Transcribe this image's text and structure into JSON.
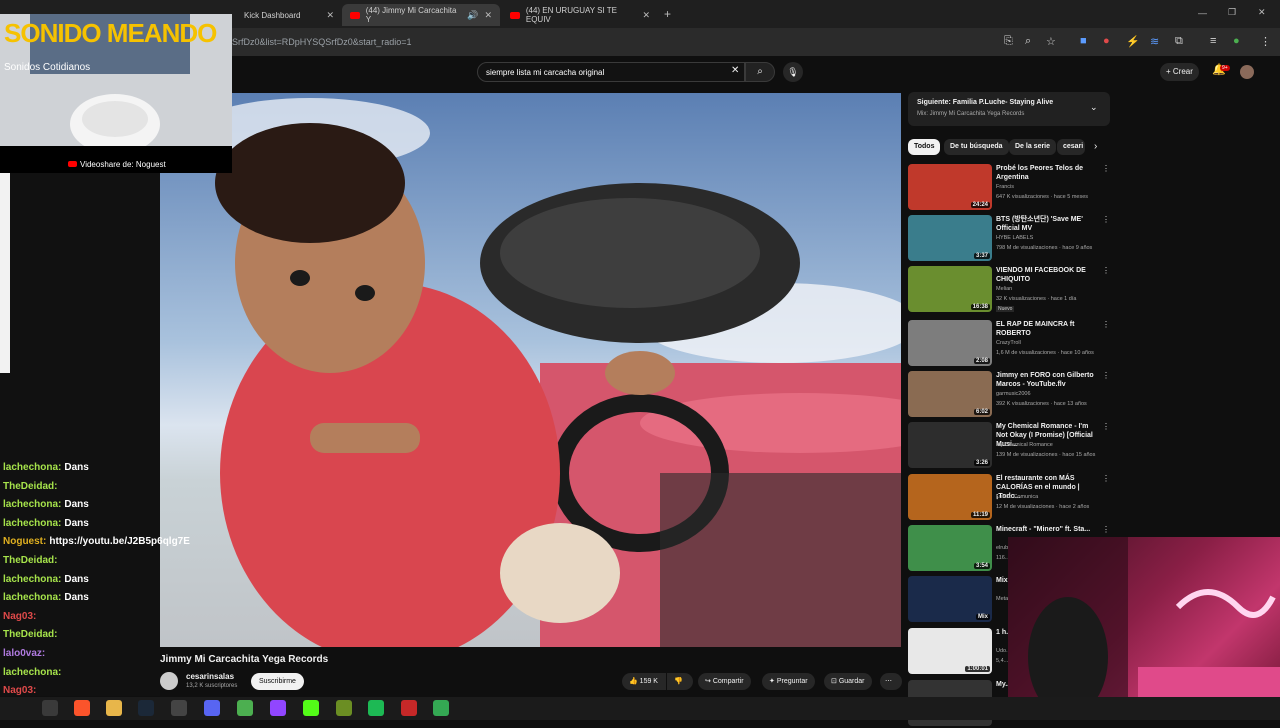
{
  "browser": {
    "tabs": [
      {
        "label": "Kick Dashboard",
        "active": false
      },
      {
        "label": "(44) Jimmy Mi Carcachita Y",
        "active": true
      },
      {
        "label": "(44) EN URUGUAY SI TE EQUIV",
        "active": false
      }
    ],
    "new_tab": "+",
    "address": "SrfDz0&list=RDpHYSQSrfDz0&start_radio=1"
  },
  "youtube": {
    "search_value": "siempre lista mi carcacha original",
    "crear_label": "Crear",
    "bell_badge": "9+",
    "video": {
      "title": "Jimmy Mi Carcachita Yega Records",
      "channel": "cesarinsalas",
      "subscribers": "13,2 K suscriptores",
      "subscribe_label": "Suscribirme",
      "likes": "159 K",
      "share_label": "Compartir",
      "ask_label": "Preguntar",
      "save_label": "Guardar"
    },
    "up_next": {
      "title": "Siguiente: Familia P.Luche- Staying Alive",
      "subtitle": "Mix: Jimmy Mi Carcachita Yega Records"
    },
    "chips": [
      "Todos",
      "De tu búsqueda",
      "De la serie",
      "cesari"
    ],
    "recommendations": [
      {
        "title": "Probé los Peores Telos de Argentina",
        "channel": "Francis",
        "meta": "647 K visualizaciones · hace 5 meses",
        "duration": "24:24",
        "color": "#c0392b"
      },
      {
        "title": "BTS (방탄소년단) 'Save ME' Official MV",
        "channel": "HYBE LABELS",
        "meta": "798 M de visualizaciones · hace 9 años",
        "duration": "3:37",
        "color": "#3a7d8c"
      },
      {
        "title": "VIENDO MI FACEBOOK DE CHIQUITO",
        "channel": "Melian",
        "meta": "32 K visualizaciones · hace 1 día",
        "duration": "16:38",
        "badge": "Nuevo",
        "color": "#6a8e2f"
      },
      {
        "title": "EL RAP DE MAINCRA ft ROBERTO",
        "channel": "CrazyTroll",
        "meta": "1,6 M de visualizaciones · hace 10 años",
        "duration": "2:08",
        "color": "#7d7d7d"
      },
      {
        "title": "Jimmy en FORO con Gilberto Marcos - YouTube.flv",
        "channel": "garmusic2006",
        "meta": "392 K visualizaciones · hace 13 años",
        "duration": "6:02",
        "color": "#8a6b52"
      },
      {
        "title": "My Chemical Romance - I'm Not Okay (I Promise) [Official Musi...",
        "channel": "My Chemical Romance",
        "meta": "139 M de visualizaciones · hace 15 años",
        "duration": "3:26",
        "color": "#2d2d2d"
      },
      {
        "title": "El restaurante con MÁS CALORÍAS en el mundo | ¡Todo...",
        "channel": "Luisito Comunica",
        "meta": "12 M de visualizaciones · hace 2 años",
        "duration": "11:19",
        "color": "#b5651d"
      },
      {
        "title": "Minecraft - \"Minero\" ft. Sta...",
        "channel": "elrub...",
        "meta": "116...",
        "duration": "3:54",
        "color": "#3f8f4a"
      },
      {
        "title": "Mix... Lar...",
        "channel": "Meta...",
        "meta": "",
        "duration": "Mix",
        "color": "#1a2a4a"
      },
      {
        "title": "1 h... inte...",
        "channel": "Udo...",
        "meta": "5,4...",
        "duration": "1:00:01",
        "color": "#e8e8e8"
      },
      {
        "title": "My...",
        "channel": "",
        "meta": "",
        "duration": "",
        "color": "#333"
      }
    ]
  },
  "overlay": {
    "brand": "SONIDO MEANDO",
    "subtitle": "Sonidos Cotidianos",
    "credit": "Videoshare de: Noguest"
  },
  "chat": [
    {
      "user": "lachechona:",
      "msg": "Dans",
      "color": "#a6e34b"
    },
    {
      "user": "TheDeidad:",
      "msg": "",
      "color": "#a6e34b"
    },
    {
      "user": "lachechona:",
      "msg": "Dans",
      "color": "#a6e34b"
    },
    {
      "user": "lachechona:",
      "msg": "Dans",
      "color": "#a6e34b"
    },
    {
      "user": "Noguest:",
      "msg": "https://youtu.be/J2B5p6qlg7E",
      "color": "#e0b020"
    },
    {
      "user": "TheDeidad:",
      "msg": "",
      "color": "#a6e34b"
    },
    {
      "user": "lachechona:",
      "msg": "Dans",
      "color": "#a6e34b"
    },
    {
      "user": "lachechona:",
      "msg": "Dans",
      "color": "#a6e34b"
    },
    {
      "user": "Nag03:",
      "msg": "",
      "color": "#e04a4a"
    },
    {
      "user": "TheDeidad:",
      "msg": "",
      "color": "#a6e34b"
    },
    {
      "user": "lalo0vaz:",
      "msg": "",
      "color": "#b07ae0"
    },
    {
      "user": "lachechona:",
      "msg": "",
      "color": "#a6e34b"
    },
    {
      "user": "Nag03:",
      "msg": "",
      "color": "#e04a4a"
    },
    {
      "user": "lachechona:",
      "msg": "",
      "color": "#a6e34b"
    }
  ]
}
